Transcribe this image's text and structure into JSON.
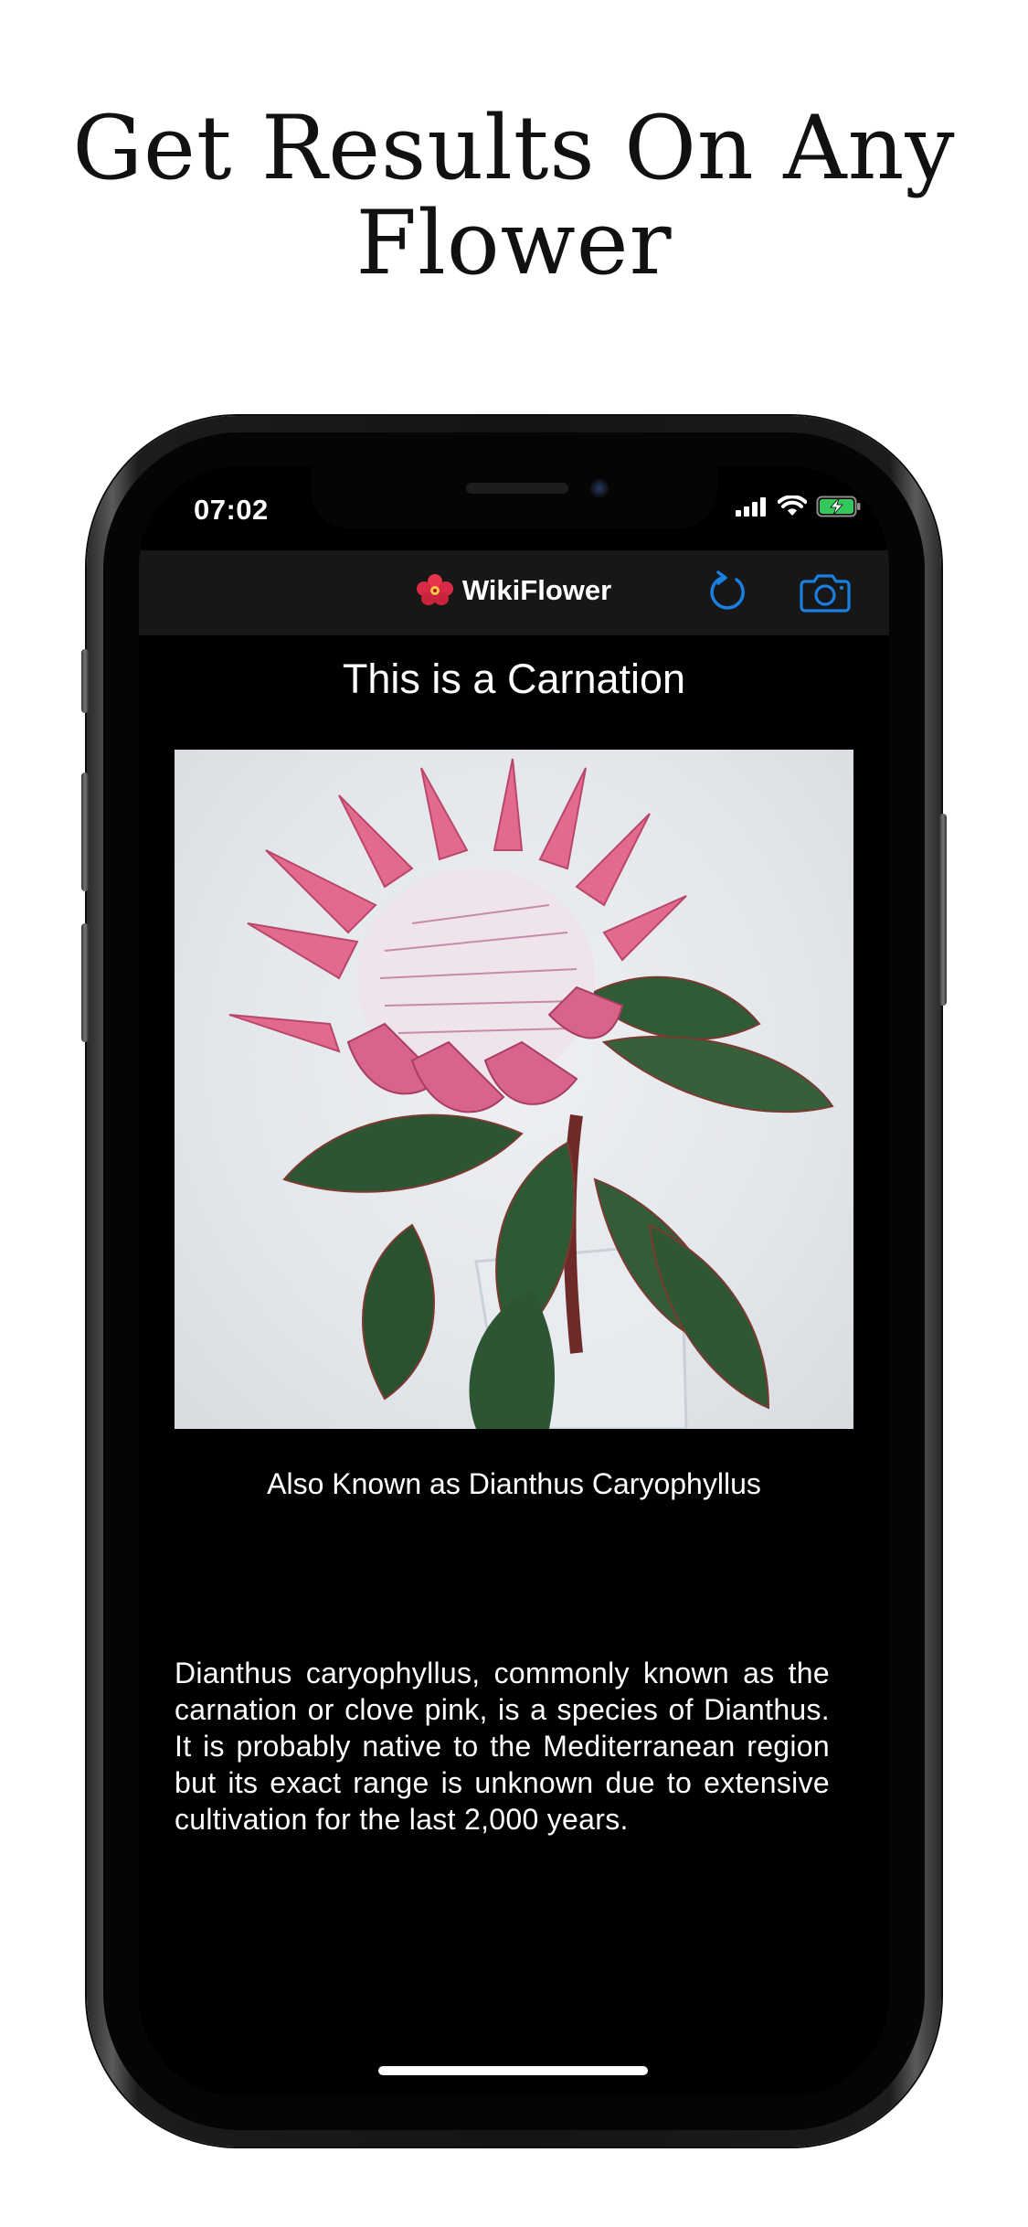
{
  "headline": {
    "line1": "Get Results On Any",
    "line2": "Flower"
  },
  "status_bar": {
    "time": "07:02",
    "battery_state": "charging",
    "battery_color": "#34c759"
  },
  "navbar": {
    "title": "WikiFlower",
    "title_icon": "hibiscus-icon",
    "refresh_icon": "refresh-icon",
    "camera_icon": "camera-icon",
    "accent_color": "#1a7fe0"
  },
  "result": {
    "title": "This is a Carnation",
    "image_alt": "flower photo",
    "also_known_as": "Also Known as Dianthus Caryophyllus",
    "description": "Dianthus caryophyllus, commonly known as the carnation or clove pink, is a species of Dianthus. It is probably native to the Mediterranean region but its exact range is unknown due to extensive cultivation for the last 2,000 years."
  }
}
